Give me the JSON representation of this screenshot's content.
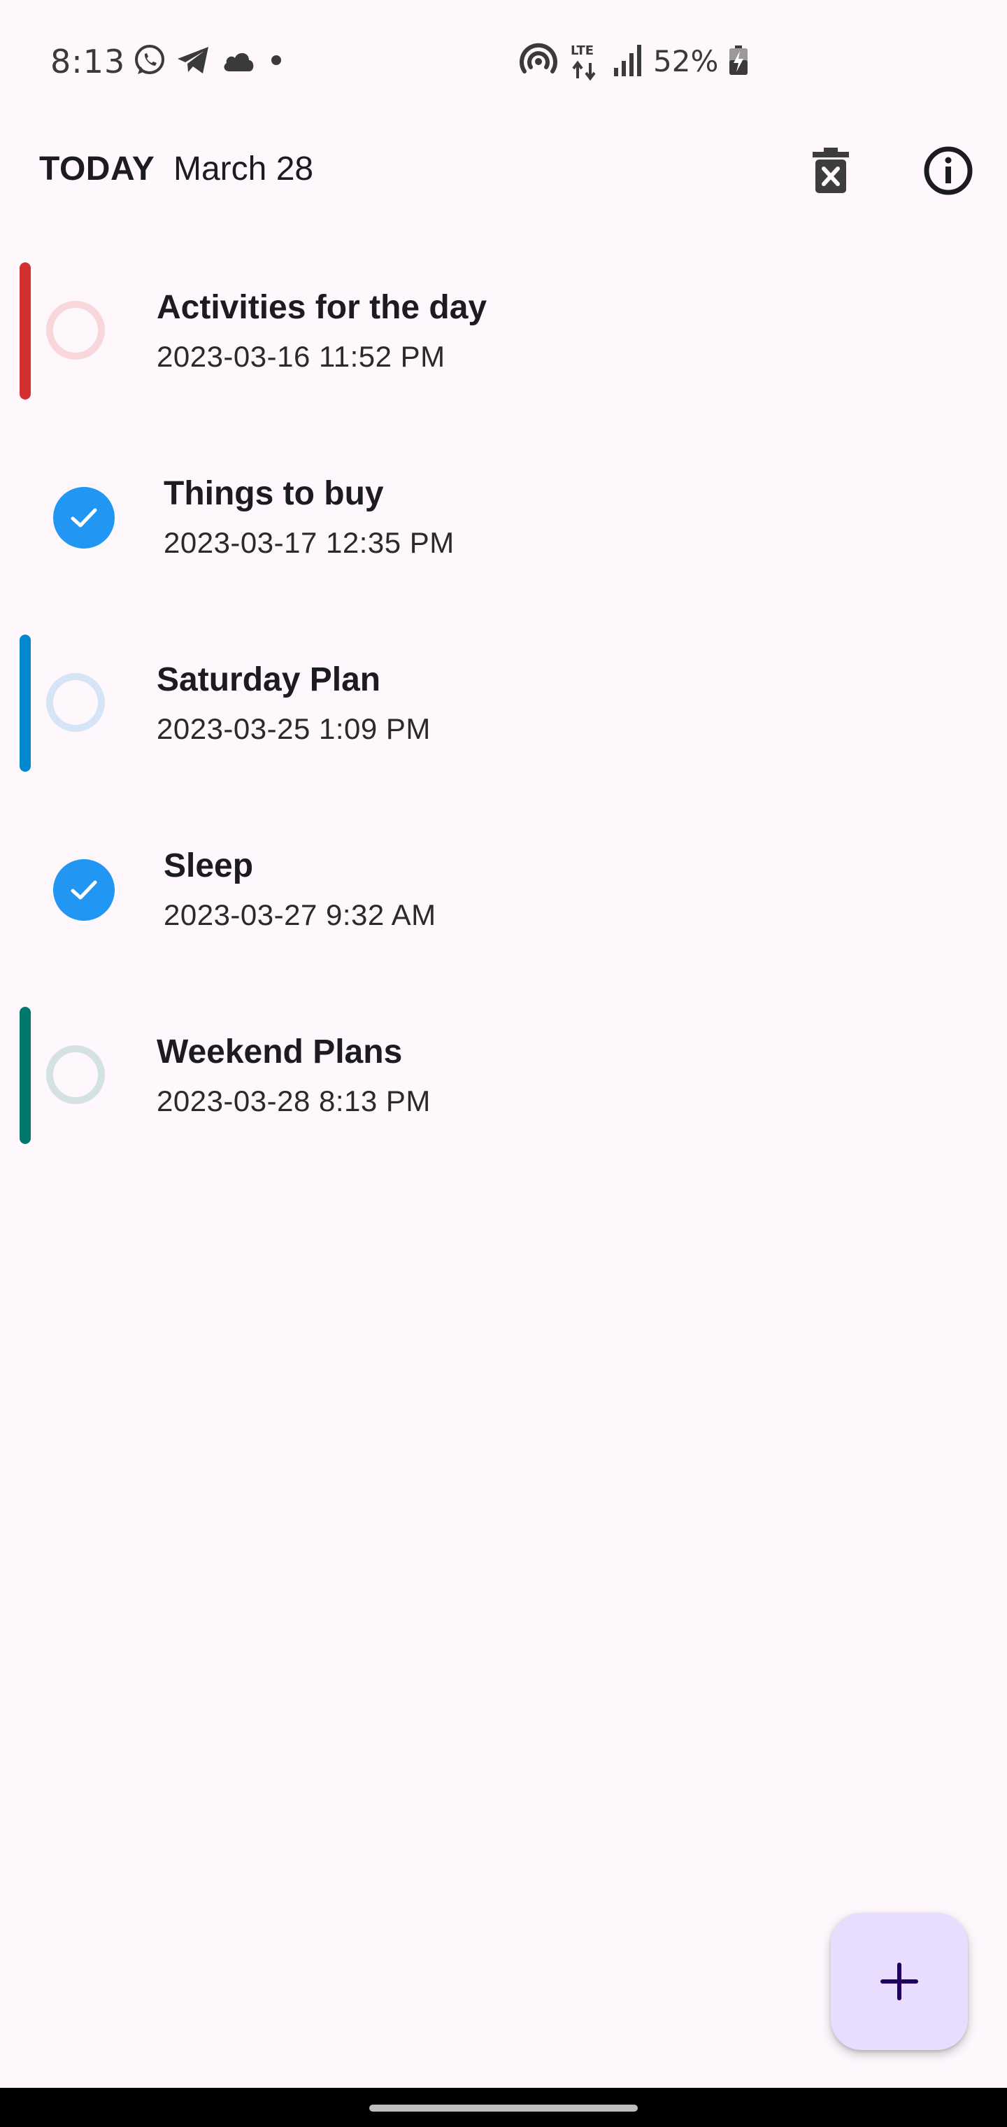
{
  "status_bar": {
    "time": "8:13",
    "battery": "52%",
    "network": "LTE",
    "left_icons": [
      "whatsapp-icon",
      "telegram-icon",
      "cloud-icon",
      "dot-icon"
    ],
    "right_icons": [
      "hotspot-icon",
      "lte-icon",
      "signal-icon",
      "battery-charging-icon"
    ]
  },
  "app_bar": {
    "title": "TODAY",
    "date": "March 28",
    "actions": [
      "delete-icon",
      "info-icon"
    ]
  },
  "tasks": [
    {
      "title": "Activities for the day",
      "date": "2023-03-16 11:52 PM",
      "done": false,
      "color": "#D32F2F"
    },
    {
      "title": "Things to buy",
      "date": "2023-03-17 12:35 PM",
      "done": true,
      "color": "#2196F3"
    },
    {
      "title": "Saturday Plan",
      "date": "2023-03-25 1:09 PM",
      "done": false,
      "color": "#0288D1"
    },
    {
      "title": "Sleep",
      "date": "2023-03-27 9:32 AM",
      "done": true,
      "color": "#2196F3"
    },
    {
      "title": "Weekend Plans",
      "date": "2023-03-28 8:13 PM",
      "done": false,
      "color": "#00796B"
    }
  ],
  "fab": {
    "icon": "plus-icon"
  },
  "colors": {
    "background": "#FEF7FC",
    "check": "#2196F3",
    "fab": "#E9DDFF",
    "fab_icon": "#21005D"
  }
}
